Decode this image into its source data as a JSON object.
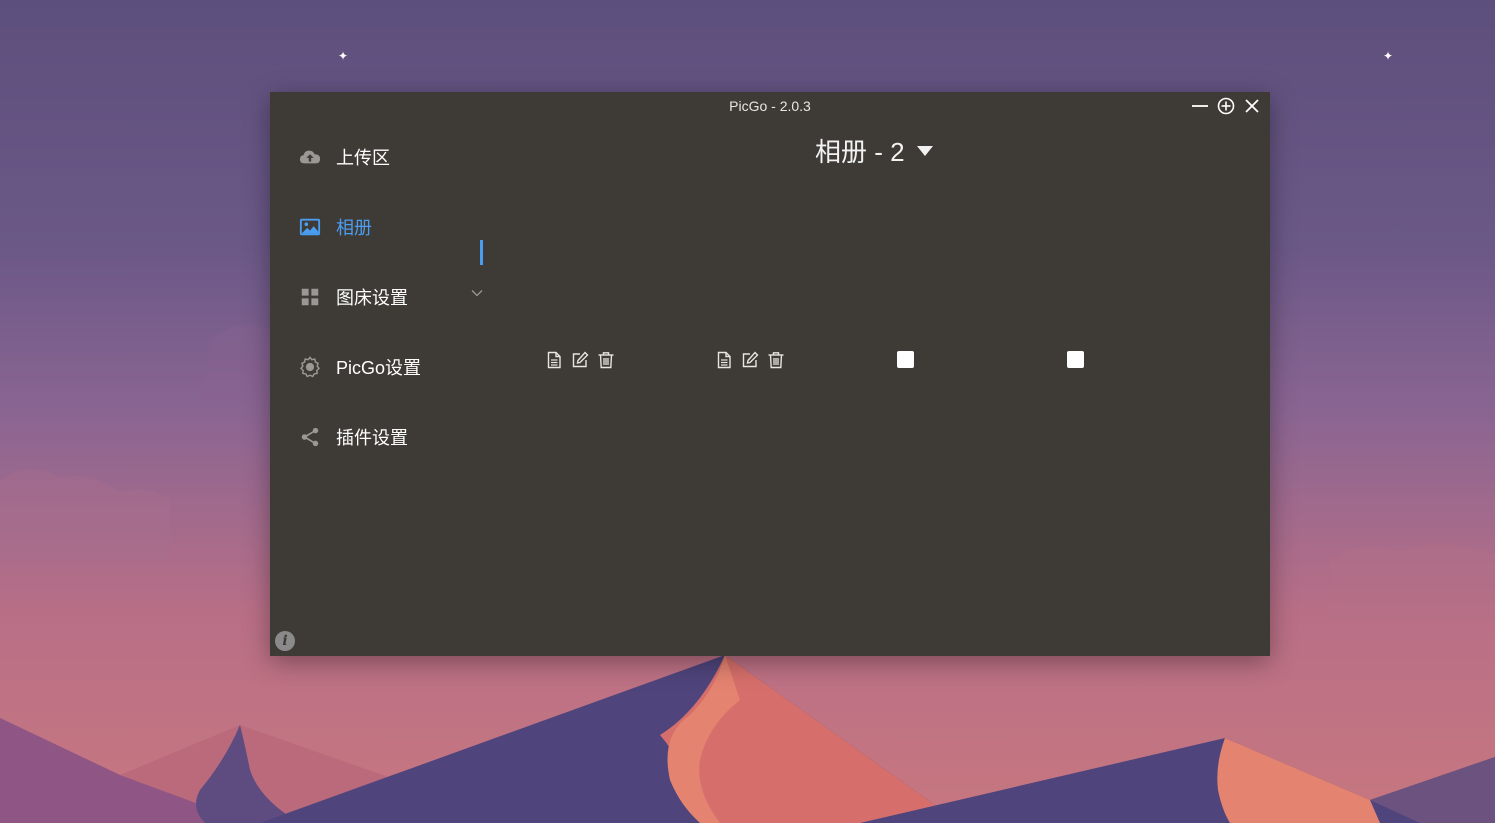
{
  "window": {
    "title": "PicGo - 2.0.3",
    "controls": {
      "minimize": "minimize-icon",
      "maximize": "plus-circle-icon",
      "close": "close-icon"
    }
  },
  "sidebar": {
    "items": [
      {
        "label": "上传区",
        "icon": "cloud-upload-icon",
        "active": false
      },
      {
        "label": "相册",
        "icon": "image-icon",
        "active": true
      },
      {
        "label": "图床设置",
        "icon": "grid-icon",
        "active": false,
        "expandable": true
      },
      {
        "label": "PicGo设置",
        "icon": "gear-icon",
        "active": false
      },
      {
        "label": "插件设置",
        "icon": "share-icon",
        "active": false
      }
    ],
    "info_icon": "i"
  },
  "album": {
    "title": "相册 - 2",
    "images": [
      {
        "actions": [
          "copy-icon",
          "edit-icon",
          "delete-icon"
        ],
        "checked": false
      },
      {
        "actions": [
          "copy-icon",
          "edit-icon",
          "delete-icon"
        ],
        "checked": false
      }
    ]
  },
  "colors": {
    "accent": "#4a9df0",
    "window_bg": "#3e3b36"
  }
}
